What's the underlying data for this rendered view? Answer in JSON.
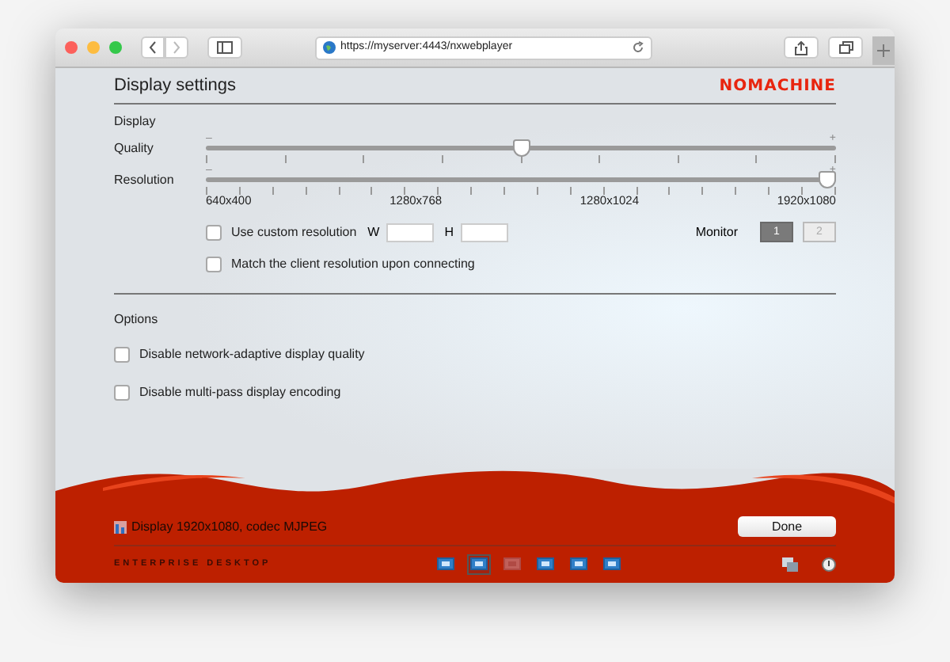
{
  "browser": {
    "url": "https://myserver:4443/nxwebplayer"
  },
  "header": {
    "title": "Display settings",
    "brand": "NOMACHINE"
  },
  "display": {
    "heading": "Display",
    "sliders": [
      {
        "label": "Quality",
        "minus": "–",
        "plus": "+",
        "level": 0.5
      },
      {
        "label": "Resolution",
        "minus": "–",
        "plus": "+",
        "level": 1.0
      }
    ],
    "resolution_labels": [
      "640x400",
      "1280x768",
      "1280x1024",
      "1920x1080"
    ],
    "custom": {
      "label": "Use custom resolution",
      "checked": false,
      "w_label": "W",
      "h_label": "H"
    },
    "monitor": {
      "label": "Monitor",
      "buttons": [
        {
          "label": "1",
          "selected": true
        },
        {
          "label": "2",
          "selected": false
        }
      ]
    },
    "match": {
      "label": "Match the client resolution upon connecting",
      "checked": false
    }
  },
  "options": {
    "heading": "Options",
    "items": [
      {
        "label": "Disable network-adaptive display quality",
        "checked": false
      },
      {
        "label": "Disable multi-pass display encoding",
        "checked": false
      }
    ]
  },
  "footer": {
    "status": "Display 1920x1080, codec MJPEG",
    "done": "Done",
    "edition": "ENTERPRISE DESKTOP",
    "tools": [
      {
        "selected": false,
        "disabled": false
      },
      {
        "selected": true,
        "disabled": false
      },
      {
        "selected": false,
        "disabled": true
      },
      {
        "selected": false,
        "disabled": false
      },
      {
        "selected": false,
        "disabled": false
      },
      {
        "selected": false,
        "disabled": false
      }
    ]
  }
}
